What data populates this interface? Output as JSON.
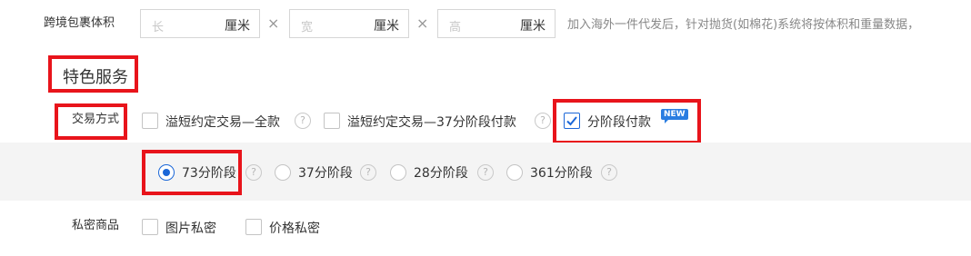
{
  "volume": {
    "label": "跨境包裹体积",
    "fields": [
      {
        "placeholder": "长",
        "unit": "厘米"
      },
      {
        "placeholder": "宽",
        "unit": "厘米"
      },
      {
        "placeholder": "高",
        "unit": "厘米"
      }
    ],
    "times": "×",
    "hint": "加入海外一件代发后，针对抛货(如棉花)系统将按体积和重量数据，"
  },
  "special_service": {
    "title": "特色服务"
  },
  "trade_mode": {
    "label": "交易方式",
    "options": [
      {
        "label": "溢短约定交易—全款",
        "checked": false
      },
      {
        "label": "溢短约定交易—37分阶段付款",
        "checked": false
      },
      {
        "label": "分阶段付款",
        "checked": true,
        "badge": "NEW"
      }
    ],
    "help_glyph": "?"
  },
  "stages": {
    "options": [
      {
        "label": "73分阶段",
        "selected": true
      },
      {
        "label": "37分阶段",
        "selected": false
      },
      {
        "label": "28分阶段",
        "selected": false
      },
      {
        "label": "361分阶段",
        "selected": false
      }
    ]
  },
  "private_goods": {
    "label": "私密商品",
    "options": [
      {
        "label": "图片私密",
        "checked": false
      },
      {
        "label": "价格私密",
        "checked": false
      }
    ]
  },
  "colors": {
    "accent": "#1b67d8",
    "highlight": "#e8141b",
    "band": "#f4f4f4"
  }
}
